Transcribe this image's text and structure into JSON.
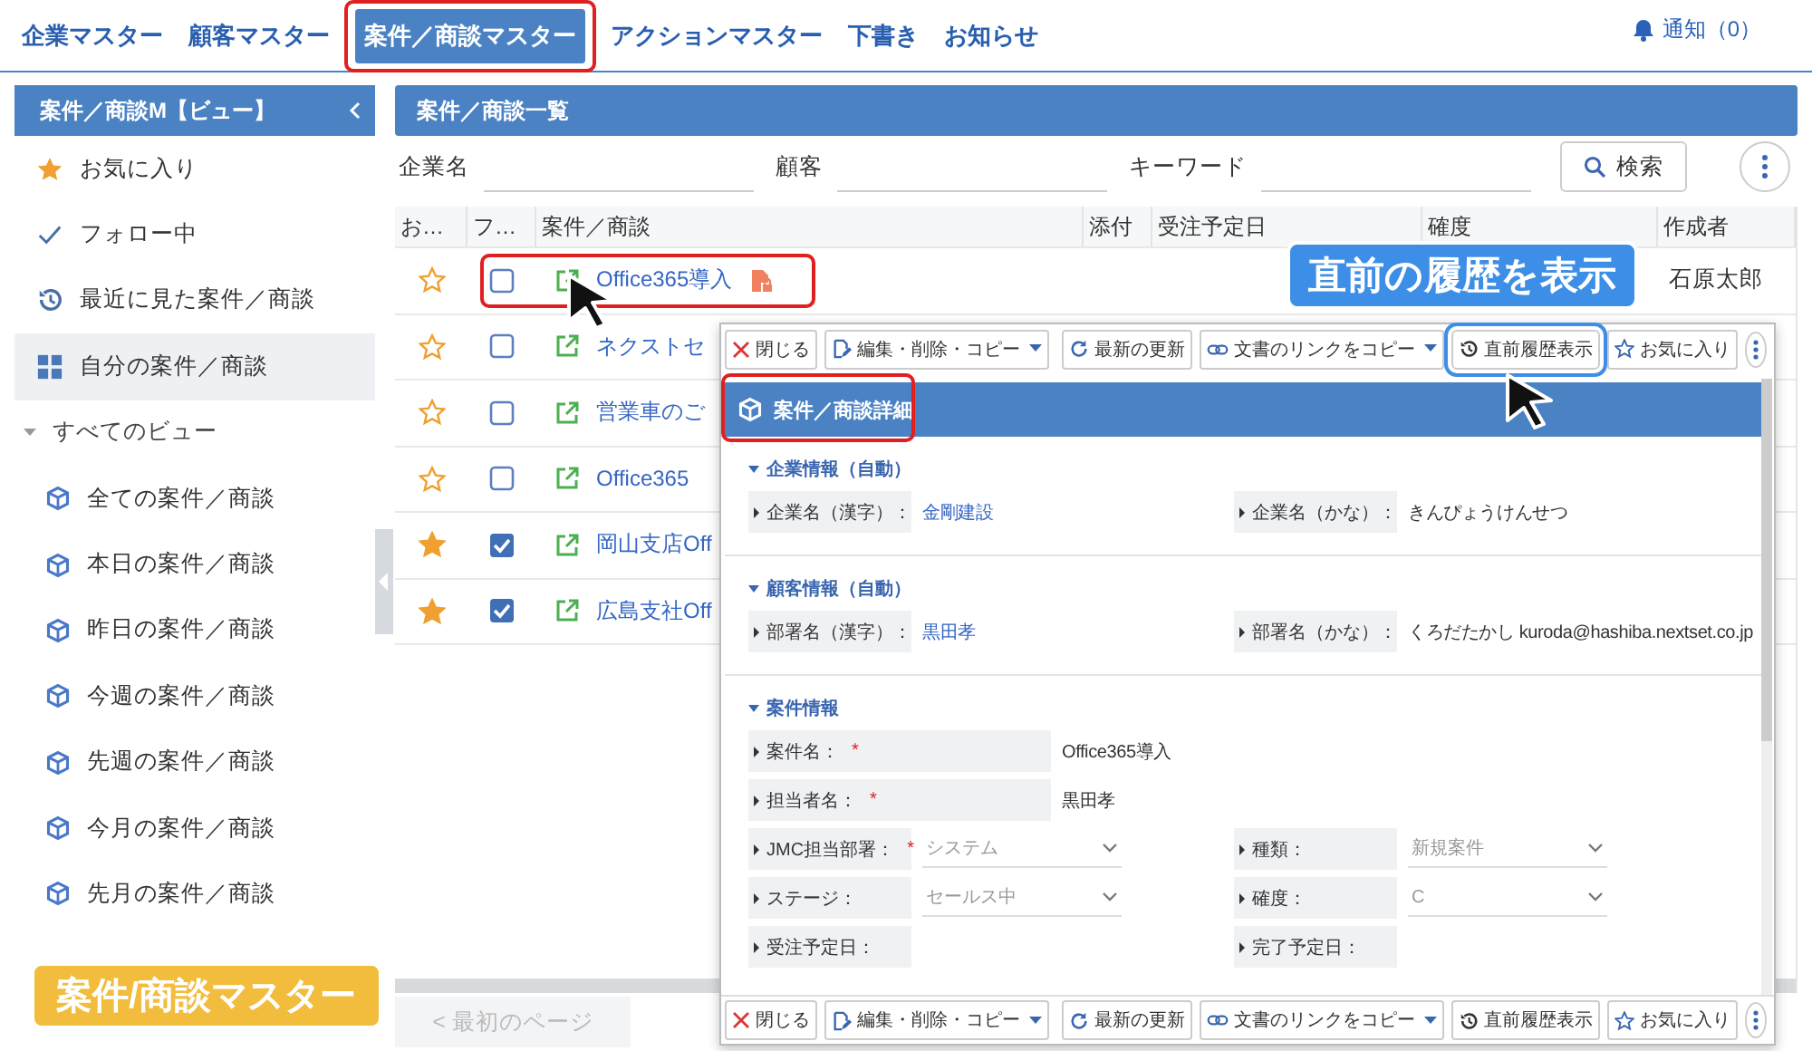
{
  "nav": {
    "tabs": [
      {
        "label": "企業マスター",
        "selected": false,
        "outlined": false
      },
      {
        "label": "顧客マスター",
        "selected": false,
        "outlined": false
      },
      {
        "label": "案件／商談マスター",
        "selected": true,
        "outlined": true
      },
      {
        "label": "アクションマスター",
        "selected": false,
        "outlined": false
      },
      {
        "label": "下書き",
        "selected": false,
        "outlined": false
      },
      {
        "label": "お知らせ",
        "selected": false,
        "outlined": false
      }
    ],
    "notification": "通知（0）"
  },
  "sidebar": {
    "title": "案件／商談M【ビュー】",
    "items": [
      {
        "kind": "star",
        "label": "お気に入り",
        "selected": false
      },
      {
        "kind": "check",
        "label": "フォロー中",
        "selected": false
      },
      {
        "kind": "history",
        "label": "最近に見た案件／商談",
        "selected": false
      },
      {
        "kind": "grid",
        "label": "自分の案件／商談",
        "selected": true
      },
      {
        "kind": "group",
        "label": "すべてのビュー",
        "selected": false,
        "expanded": true,
        "children": [
          {
            "kind": "view",
            "label": "全ての案件／商談",
            "selected": false
          },
          {
            "kind": "view",
            "label": "本日の案件／商談",
            "selected": false
          },
          {
            "kind": "view",
            "label": "昨日の案件／商談",
            "selected": false
          },
          {
            "kind": "view",
            "label": "今週の案件／商談",
            "selected": false
          },
          {
            "kind": "view",
            "label": "先週の案件／商談",
            "selected": false
          },
          {
            "kind": "view",
            "label": "今月の案件／商談",
            "selected": false
          },
          {
            "kind": "view",
            "label": "先月の案件／商談",
            "selected": false
          }
        ]
      }
    ]
  },
  "list": {
    "title": "案件／商談一覧",
    "filters": [
      "企業名",
      "顧客",
      "キーワード"
    ],
    "search_button": "検索",
    "columns": [
      "お…",
      "フ…",
      "案件／商談",
      "添付",
      "受注予定日",
      "確度",
      "作成者"
    ],
    "rows": [
      {
        "favorite": false,
        "follow": false,
        "title": "Office365導入",
        "badge": true,
        "outlined": true,
        "author": "石原太郎"
      },
      {
        "favorite": false,
        "follow": false,
        "title": "ネクストセ"
      },
      {
        "favorite": false,
        "follow": false,
        "title": "営業車のご"
      },
      {
        "favorite": false,
        "follow": false,
        "title": "Office365"
      },
      {
        "favorite": true,
        "follow": true,
        "title": "岡山支店Off"
      },
      {
        "favorite": true,
        "follow": true,
        "title": "広島支社Off"
      }
    ],
    "pagination": [
      "< 最初のページ"
    ]
  },
  "detail": {
    "toolbar": [
      {
        "kind": "close",
        "label": "閉じる",
        "dropdown": false,
        "outlined": false
      },
      {
        "kind": "edit",
        "label": "編集・削除・コピー",
        "dropdown": true,
        "outlined": false
      },
      {
        "kind": "refresh",
        "label": "最新の更新",
        "dropdown": false,
        "outlined": false
      },
      {
        "kind": "link",
        "label": "文書のリンクをコピー",
        "dropdown": true,
        "outlined": false
      },
      {
        "kind": "history",
        "label": "直前履歴表示",
        "dropdown": false,
        "outlined": true
      },
      {
        "kind": "star",
        "label": "お気に入り",
        "dropdown": false,
        "outlined": false
      }
    ],
    "bottom_toolbar": [
      {
        "kind": "close",
        "label": "閉じる",
        "dropdown": false,
        "outlined": false
      },
      {
        "kind": "edit",
        "label": "編集・削除・コピー",
        "dropdown": true,
        "outlined": false
      },
      {
        "kind": "refresh",
        "label": "最新の更新",
        "dropdown": false,
        "outlined": false
      },
      {
        "kind": "link",
        "label": "文書のリンクをコピー",
        "dropdown": true,
        "outlined": false
      },
      {
        "kind": "history",
        "label": "直前履歴表示",
        "dropdown": false,
        "outlined": false
      },
      {
        "kind": "star",
        "label": "お気に入り",
        "dropdown": false,
        "outlined": false
      }
    ],
    "title": "案件／商談詳細",
    "title_outlined": true,
    "sections": [
      {
        "title": "企業情報（自動）",
        "expanded": true,
        "rows": [
          [
            {
              "label": "企業名（漢字）：",
              "kind": "link",
              "value": "金剛建設"
            },
            {
              "label": "企業名（かな）：",
              "kind": "text",
              "value": "きんぴょうけんせつ"
            }
          ]
        ]
      },
      {
        "title": "顧客情報（自動）",
        "expanded": true,
        "rows": [
          [
            {
              "label": "部署名（漢字）：",
              "kind": "link",
              "value": "黒田孝"
            },
            {
              "label": "部署名（かな）：",
              "kind": "text",
              "value": "くろだたかし kuroda@hashiba.nextset.co.jp"
            }
          ]
        ]
      },
      {
        "title": "案件情報",
        "expanded": true,
        "rows": [
          [
            {
              "label": "案件名：",
              "required": "*",
              "kind": "text",
              "value": "Office365導入"
            }
          ],
          [
            {
              "label": "担当者名：",
              "required": "*",
              "kind": "text",
              "value": "黒田孝"
            }
          ],
          [
            {
              "label": "JMC担当部署：",
              "required": "*",
              "kind": "select",
              "disabled": true,
              "value": "システム"
            },
            {
              "label": "種類：",
              "kind": "select",
              "disabled": true,
              "value": "新規案件"
            }
          ],
          [
            {
              "label": "ステージ：",
              "kind": "select",
              "disabled": true,
              "value": "セールス中"
            },
            {
              "label": "確度：",
              "kind": "select",
              "disabled": true,
              "value": "C"
            }
          ],
          [
            {
              "label": "受注予定日：",
              "kind": "text"
            },
            {
              "label": "完了予定日：",
              "kind": "text"
            }
          ]
        ]
      }
    ]
  },
  "callouts": [
    {
      "text": "直前の履歴を表示",
      "color": "#3d8ee6"
    },
    {
      "text": "案件/商談マスター",
      "color": "#f2bc3c"
    }
  ]
}
